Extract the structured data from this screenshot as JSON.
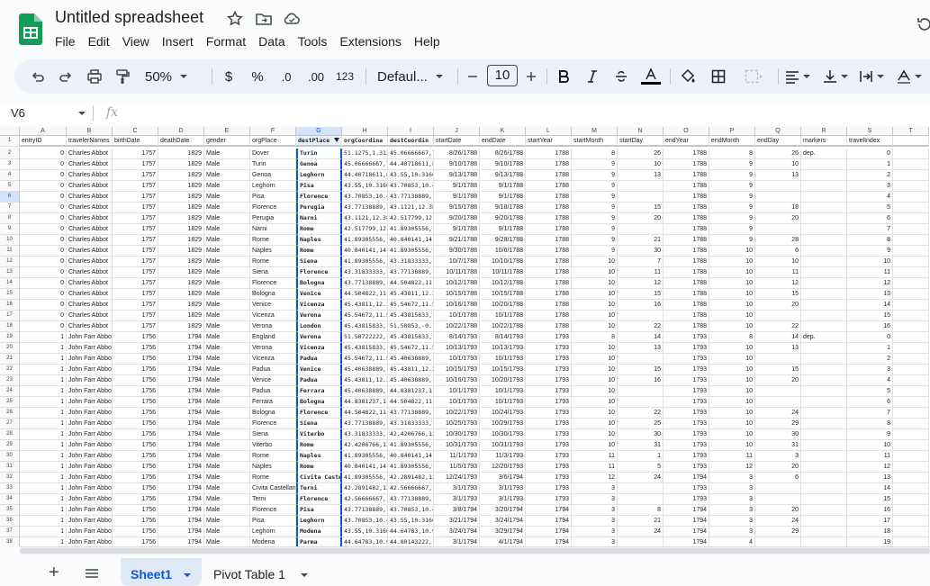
{
  "doc": {
    "title": "Untitled spreadsheet"
  },
  "menu": [
    "File",
    "Edit",
    "View",
    "Insert",
    "Format",
    "Data",
    "Tools",
    "Extensions",
    "Help"
  ],
  "toolbar": {
    "zoom": "50%",
    "currency": "$",
    "percent": "%",
    "dec_less": ".0",
    "dec_more": ".00",
    "format_123": "123",
    "font": "Defaul...",
    "font_size": "10"
  },
  "formula": {
    "name_box": "V6",
    "fx": "fx"
  },
  "columns": [
    {
      "letter": "A",
      "header": "entryID"
    },
    {
      "letter": "B",
      "header": "travelerNames"
    },
    {
      "letter": "C",
      "header": "birthDate"
    },
    {
      "letter": "D",
      "header": "deathDate"
    },
    {
      "letter": "E",
      "header": "gender"
    },
    {
      "letter": "F",
      "header": "orgPlace"
    },
    {
      "letter": "G",
      "header": "destPlace"
    },
    {
      "letter": "H",
      "header": "orgCoordina"
    },
    {
      "letter": "I",
      "header": "destCoordin"
    },
    {
      "letter": "J",
      "header": "startDate"
    },
    {
      "letter": "K",
      "header": "endDate"
    },
    {
      "letter": "L",
      "header": "startYear"
    },
    {
      "letter": "M",
      "header": "startMonth"
    },
    {
      "letter": "N",
      "header": "startDay"
    },
    {
      "letter": "O",
      "header": "endYear"
    },
    {
      "letter": "P",
      "header": "endMonth"
    },
    {
      "letter": "Q",
      "header": "endDay"
    },
    {
      "letter": "R",
      "header": "markers"
    },
    {
      "letter": "S",
      "header": "travelIndex"
    },
    {
      "letter": "T",
      "header": ""
    }
  ],
  "rows": [
    [
      "0",
      "Charles Abbot",
      "1757",
      "1829",
      "Male",
      "Dover",
      "Turin",
      "51.1275,1.31222",
      "45.06666667,7.",
      "8/26/1788",
      "8/26/1788",
      "1788",
      "8",
      "26",
      "1788",
      "8",
      "26",
      "dep.",
      "0"
    ],
    [
      "0",
      "Charles Abbot",
      "1757",
      "1829",
      "Male",
      "Turin",
      "Genoa",
      "45.06666667,7.7",
      "44.40718611,8.",
      "9/10/1788",
      "9/10/1788",
      "1788",
      "9",
      "10",
      "1788",
      "9",
      "10",
      "",
      "1"
    ],
    [
      "0",
      "Charles Abbot",
      "1757",
      "1829",
      "Male",
      "Genoa",
      "Leghorn",
      "44.40718611,8.9",
      "43.55,10.31666",
      "9/13/1788",
      "9/13/1788",
      "1788",
      "9",
      "13",
      "1788",
      "9",
      "13",
      "",
      "2"
    ],
    [
      "0",
      "Charles Abbot",
      "1757",
      "1829",
      "Male",
      "Leghorn",
      "Pisa",
      "43.55,10.316666",
      "43.70853,10.40",
      "9/1/1788",
      "9/1/1788",
      "1788",
      "9",
      "",
      "1788",
      "9",
      "",
      "",
      "3"
    ],
    [
      "0",
      "Charles Abbot",
      "1757",
      "1829",
      "Male",
      "Pisa",
      "Florence",
      "43.70853,10.403",
      "43.77138889,11",
      "9/1/1788",
      "9/1/1788",
      "1788",
      "9",
      "",
      "1788",
      "9",
      "",
      "",
      "4"
    ],
    [
      "0",
      "Charles Abbot",
      "1757",
      "1829",
      "Male",
      "Florence",
      "Perugia",
      "43.77138889,11.",
      "43.1121,12.388",
      "9/15/1788",
      "9/18/1788",
      "1788",
      "9",
      "15",
      "1788",
      "9",
      "18",
      "",
      "5"
    ],
    [
      "0",
      "Charles Abbot",
      "1757",
      "1829",
      "Male",
      "Perugia",
      "Narni",
      "43.1121,12.3888",
      "42.517799,12.5",
      "9/20/1788",
      "9/20/1788",
      "1788",
      "9",
      "20",
      "1788",
      "9",
      "20",
      "",
      "6"
    ],
    [
      "0",
      "Charles Abbot",
      "1757",
      "1829",
      "Male",
      "Narni",
      "Rome",
      "42.517799,12.51",
      "41.89305556,12",
      "9/1/1788",
      "9/1/1788",
      "1788",
      "9",
      "",
      "1788",
      "9",
      "",
      "",
      "7"
    ],
    [
      "0",
      "Charles Abbot",
      "1757",
      "1829",
      "Male",
      "Rome",
      "Naples",
      "41.89305556,12.",
      "40.840141,14.2",
      "9/21/1788",
      "9/28/1788",
      "1788",
      "9",
      "21",
      "1788",
      "9",
      "28",
      "",
      "8"
    ],
    [
      "0",
      "Charles Abbot",
      "1757",
      "1829",
      "Male",
      "Naples",
      "Rome",
      "40.840141,14.25",
      "41.89305556,12",
      "9/30/1788",
      "10/6/1788",
      "1788",
      "9",
      "30",
      "1788",
      "10",
      "6",
      "",
      "9"
    ],
    [
      "0",
      "Charles Abbot",
      "1757",
      "1829",
      "Male",
      "Rome",
      "Siena",
      "41.89305556,12.",
      "43.31833333,11",
      "10/7/1788",
      "10/10/1788",
      "1788",
      "10",
      "7",
      "1788",
      "10",
      "10",
      "",
      "10"
    ],
    [
      "0",
      "Charles Abbot",
      "1757",
      "1829",
      "Male",
      "Siena",
      "Florence",
      "43.31833333,11.",
      "43.77138889,11",
      "10/11/1788",
      "10/11/1788",
      "1788",
      "10",
      "11",
      "1788",
      "10",
      "11",
      "",
      "11"
    ],
    [
      "0",
      "Charles Abbot",
      "1757",
      "1829",
      "Male",
      "Florence",
      "Bologna",
      "43.77138889,11.",
      "44.504822,11.3",
      "10/12/1788",
      "10/12/1788",
      "1788",
      "10",
      "12",
      "1788",
      "10",
      "12",
      "",
      "12"
    ],
    [
      "0",
      "Charles Abbot",
      "1757",
      "1829",
      "Male",
      "Bologna",
      "Venice",
      "44.504822,11.34",
      "45.43811,12.31",
      "10/15/1788",
      "10/15/1788",
      "1788",
      "10",
      "15",
      "1788",
      "10",
      "15",
      "",
      "13"
    ],
    [
      "0",
      "Charles Abbot",
      "1757",
      "1829",
      "Male",
      "Venice",
      "Vicenza",
      "45.43811,12.318",
      "45.54672,11.54",
      "10/16/1788",
      "10/20/1788",
      "1788",
      "10",
      "16",
      "1788",
      "10",
      "20",
      "",
      "14"
    ],
    [
      "0",
      "Charles Abbot",
      "1757",
      "1829",
      "Male",
      "Vicenza",
      "Verona",
      "45.54672,11.547",
      "45.43815833,10",
      "10/1/1788",
      "10/1/1788",
      "1788",
      "10",
      "",
      "1788",
      "10",
      "",
      "",
      "15"
    ],
    [
      "0",
      "Charles Abbot",
      "1757",
      "1829",
      "Male",
      "Verona",
      "London",
      "45.43815833,10.",
      "51.50853,-0.12",
      "10/22/1788",
      "10/22/1788",
      "1788",
      "10",
      "22",
      "1788",
      "10",
      "22",
      "",
      "16"
    ],
    [
      "1",
      "John Farr Abbot",
      "1756",
      "1794",
      "Male",
      "England",
      "Verona",
      "51.50722222,-0.",
      "45.43815833,10",
      "8/14/1793",
      "8/14/1793",
      "1793",
      "8",
      "14",
      "1793",
      "8",
      "14",
      "dep.",
      "0"
    ],
    [
      "1",
      "John Farr Abbot",
      "1756",
      "1794",
      "Male",
      "Verona",
      "Vicenza",
      "45.43815833,10.",
      "45.54672,11.54",
      "10/13/1793",
      "10/13/1793",
      "1793",
      "10",
      "13",
      "1793",
      "10",
      "13",
      "",
      "1"
    ],
    [
      "1",
      "John Farr Abbot",
      "1756",
      "1794",
      "Male",
      "Vicenza",
      "Padua",
      "45.54672,11.547",
      "45.40638889,11",
      "10/1/1793",
      "10/1/1793",
      "1793",
      "10",
      "",
      "1793",
      "10",
      "",
      "",
      "2"
    ],
    [
      "1",
      "John Farr Abbot",
      "1756",
      "1794",
      "Male",
      "Padua",
      "Venice",
      "45.40638889,11.",
      "45.43811,12.31",
      "10/15/1793",
      "10/15/1793",
      "1793",
      "10",
      "15",
      "1793",
      "10",
      "15",
      "",
      "3"
    ],
    [
      "1",
      "John Farr Abbot",
      "1756",
      "1794",
      "Male",
      "Venice",
      "Padua",
      "45.43811,12.318",
      "45.40638889,11",
      "10/16/1793",
      "10/20/1793",
      "1793",
      "10",
      "16",
      "1793",
      "10",
      "20",
      "",
      "4"
    ],
    [
      "1",
      "John Farr Abbot",
      "1756",
      "1794",
      "Male",
      "Padua",
      "Ferrara",
      "45.40638889,11.",
      "44.8381237,11.",
      "10/1/1793",
      "10/1/1793",
      "1793",
      "10",
      "",
      "1793",
      "10",
      "",
      "",
      "5"
    ],
    [
      "1",
      "John Farr Abbot",
      "1756",
      "1794",
      "Male",
      "Ferrara",
      "Bologna",
      "44.8381237,11.6",
      "44.504822,11.3",
      "10/1/1793",
      "10/1/1793",
      "1793",
      "10",
      "",
      "1793",
      "10",
      "",
      "",
      "6"
    ],
    [
      "1",
      "John Farr Abbot",
      "1756",
      "1794",
      "Male",
      "Bologna",
      "Florence",
      "44.504822,11.34",
      "43.77138889,11",
      "10/22/1793",
      "10/24/1793",
      "1793",
      "10",
      "22",
      "1793",
      "10",
      "24",
      "",
      "7"
    ],
    [
      "1",
      "John Farr Abbot",
      "1756",
      "1794",
      "Male",
      "Florence",
      "Siena",
      "43.77138889,11.",
      "43.31833333,11",
      "10/25/1793",
      "10/29/1793",
      "1793",
      "10",
      "25",
      "1793",
      "10",
      "29",
      "",
      "8"
    ],
    [
      "1",
      "John Farr Abbot",
      "1756",
      "1794",
      "Male",
      "Siena",
      "Viterbo",
      "43.31833333,11.",
      "42.4206766,12.",
      "10/30/1793",
      "10/30/1793",
      "1793",
      "10",
      "30",
      "1793",
      "10",
      "30",
      "",
      "9"
    ],
    [
      "1",
      "John Farr Abbot",
      "1756",
      "1794",
      "Male",
      "Viterbo",
      "Rome",
      "42.4206766,12.1",
      "41.89305556,12",
      "10/31/1793",
      "10/31/1793",
      "1793",
      "10",
      "31",
      "1793",
      "10",
      "31",
      "",
      "10"
    ],
    [
      "1",
      "John Farr Abbot",
      "1756",
      "1794",
      "Male",
      "Rome",
      "Naples",
      "41.89305556,12.",
      "40.840141,14.2",
      "11/1/1793",
      "11/3/1793",
      "1793",
      "11",
      "1",
      "1793",
      "11",
      "3",
      "",
      "11"
    ],
    [
      "1",
      "John Farr Abbot",
      "1756",
      "1794",
      "Male",
      "Naples",
      "Rome",
      "40.840141,14.25",
      "41.89305556,12",
      "11/5/1793",
      "12/20/1793",
      "1793",
      "11",
      "5",
      "1793",
      "12",
      "20",
      "",
      "12"
    ],
    [
      "1",
      "John Farr Abbot",
      "1756",
      "1794",
      "Male",
      "Rome",
      "Civita Castel",
      "41.89305556,12.",
      "42.2891482,12.",
      "12/24/1793",
      "3/6/1794",
      "1793",
      "12",
      "24",
      "1794",
      "3",
      "6",
      "",
      "13"
    ],
    [
      "1",
      "John Farr Abbot",
      "1756",
      "1794",
      "Male",
      "Civita Castellan",
      "Terni",
      "42.2891482,12.4",
      "42.56666667,12",
      "3/1/1793",
      "3/1/1793",
      "1793",
      "3",
      "",
      "1793",
      "3",
      "",
      "",
      "14"
    ],
    [
      "1",
      "John Farr Abbot",
      "1756",
      "1794",
      "Male",
      "Terni",
      "Florence",
      "42.56666667,12.",
      "43.77138889,11",
      "3/1/1793",
      "3/1/1793",
      "1793",
      "3",
      "",
      "1793",
      "3",
      "",
      "",
      "15"
    ],
    [
      "1",
      "John Farr Abbot",
      "1756",
      "1794",
      "Male",
      "Florence",
      "Pisa",
      "43.77138889,11.",
      "43.70853,10.40",
      "3/8/1794",
      "3/20/1794",
      "1794",
      "3",
      "8",
      "1794",
      "3",
      "20",
      "",
      "16"
    ],
    [
      "1",
      "John Farr Abbot",
      "1756",
      "1794",
      "Male",
      "Pisa",
      "Leghorn",
      "43.70853,10.403",
      "43.55,10.31666",
      "3/21/1794",
      "3/24/1794",
      "1794",
      "3",
      "21",
      "1794",
      "3",
      "24",
      "",
      "17"
    ],
    [
      "1",
      "John Farr Abbot",
      "1756",
      "1794",
      "Male",
      "Leghorn",
      "Modena",
      "43.55,10.316666",
      "44.64783,10.92",
      "3/24/1794",
      "3/29/1794",
      "1794",
      "3",
      "24",
      "1794",
      "3",
      "29",
      "",
      "18"
    ],
    [
      "1",
      "John Farr Abbot",
      "1756",
      "1794",
      "Male",
      "Modena",
      "Parma",
      "44.64783,10.925",
      "44.80143222,10",
      "3/1/1794",
      "4/1/1794",
      "1794",
      "3",
      "",
      "1794",
      "4",
      "",
      "",
      "19"
    ]
  ],
  "sheets": {
    "active": "Sheet1",
    "other": "Pivot Table 1"
  }
}
